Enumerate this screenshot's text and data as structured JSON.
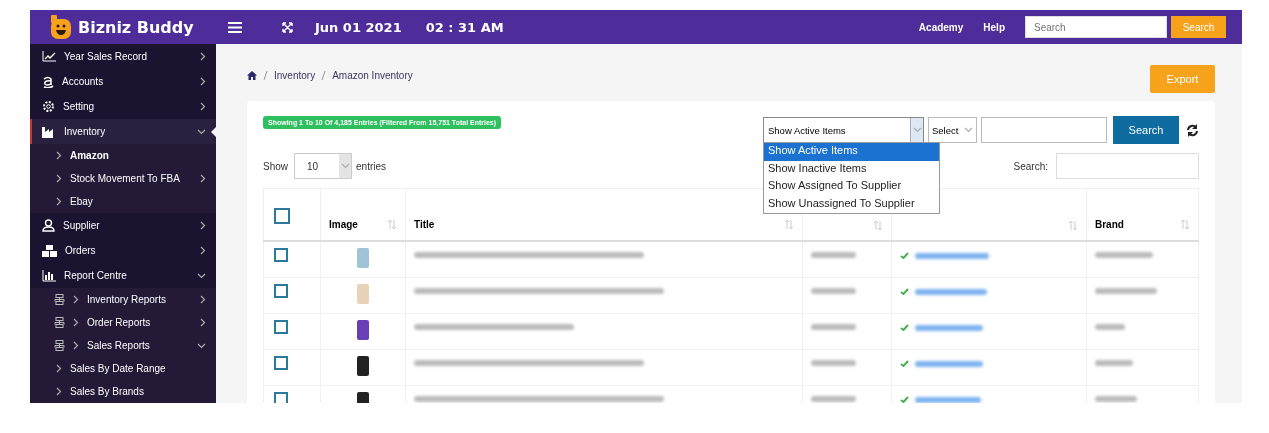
{
  "topbar": {
    "logo_text": "Bizniz Buddy",
    "date": "Jun 01 2021",
    "time": "02 : 31 AM",
    "links": [
      "Academy",
      "Help"
    ],
    "search": {
      "placeholder": "Search"
    },
    "search_button": "Search"
  },
  "sidebar": {
    "items": [
      {
        "label": "Year Sales Record",
        "expanded": false,
        "selected": false
      },
      {
        "label": "Accounts",
        "expanded": false,
        "selected": false
      },
      {
        "label": "Setting",
        "expanded": false,
        "selected": false
      },
      {
        "label": "Inventory",
        "expanded": true,
        "selected": true,
        "children": [
          {
            "label": "Amazon",
            "selected": true
          },
          {
            "label": "Stock Movement To FBA",
            "expanded": false,
            "selected": false
          },
          {
            "label": "Ebay",
            "selected": false
          }
        ]
      },
      {
        "label": "Supplier",
        "expanded": false,
        "selected": false
      },
      {
        "label": "Orders",
        "expanded": false,
        "selected": false
      },
      {
        "label": "Report Centre",
        "expanded": true,
        "selected": false,
        "children": [
          {
            "label": "Inventory Reports",
            "expanded": false,
            "selected": false,
            "kind": "report"
          },
          {
            "label": "Order Reports",
            "expanded": false,
            "selected": false,
            "kind": "report"
          },
          {
            "label": "Sales Reports",
            "expanded": true,
            "selected": false,
            "kind": "report",
            "children": [
              {
                "label": "Sales By Date Range",
                "selected": false
              },
              {
                "label": "Sales By Brands",
                "selected": false
              }
            ]
          }
        ]
      }
    ]
  },
  "breadcrumb": [
    "Inventory",
    "Amazon Inventory"
  ],
  "export_button": "Export",
  "entries_badge": "Showing 1 To 10 Of 4,185 Entries (Filtered From 15,751 Total Entries)",
  "filter": {
    "value": "Show Active Items",
    "expanded": true,
    "options": [
      {
        "label": "Show Active Items",
        "selected": true
      },
      {
        "label": "Show Inactive Items",
        "selected": false
      },
      {
        "label": "Show Assigned To Supplier",
        "selected": false
      },
      {
        "label": "Show Unassigned To Supplier",
        "selected": false
      }
    ]
  },
  "select_field": {
    "value": "Select"
  },
  "search_button": "Search",
  "length": {
    "before": "Show",
    "value": "10",
    "after": "entries"
  },
  "table_search": {
    "label": "Search:"
  },
  "table": {
    "header_checked": false,
    "columns": [
      {
        "label": "Image"
      },
      {
        "label": "Title"
      },
      {},
      {},
      {
        "label": "Brand"
      }
    ],
    "rows": [
      {
        "checked": false
      },
      {
        "checked": false
      },
      {
        "checked": false
      },
      {
        "checked": false
      },
      {
        "checked": false
      }
    ]
  }
}
